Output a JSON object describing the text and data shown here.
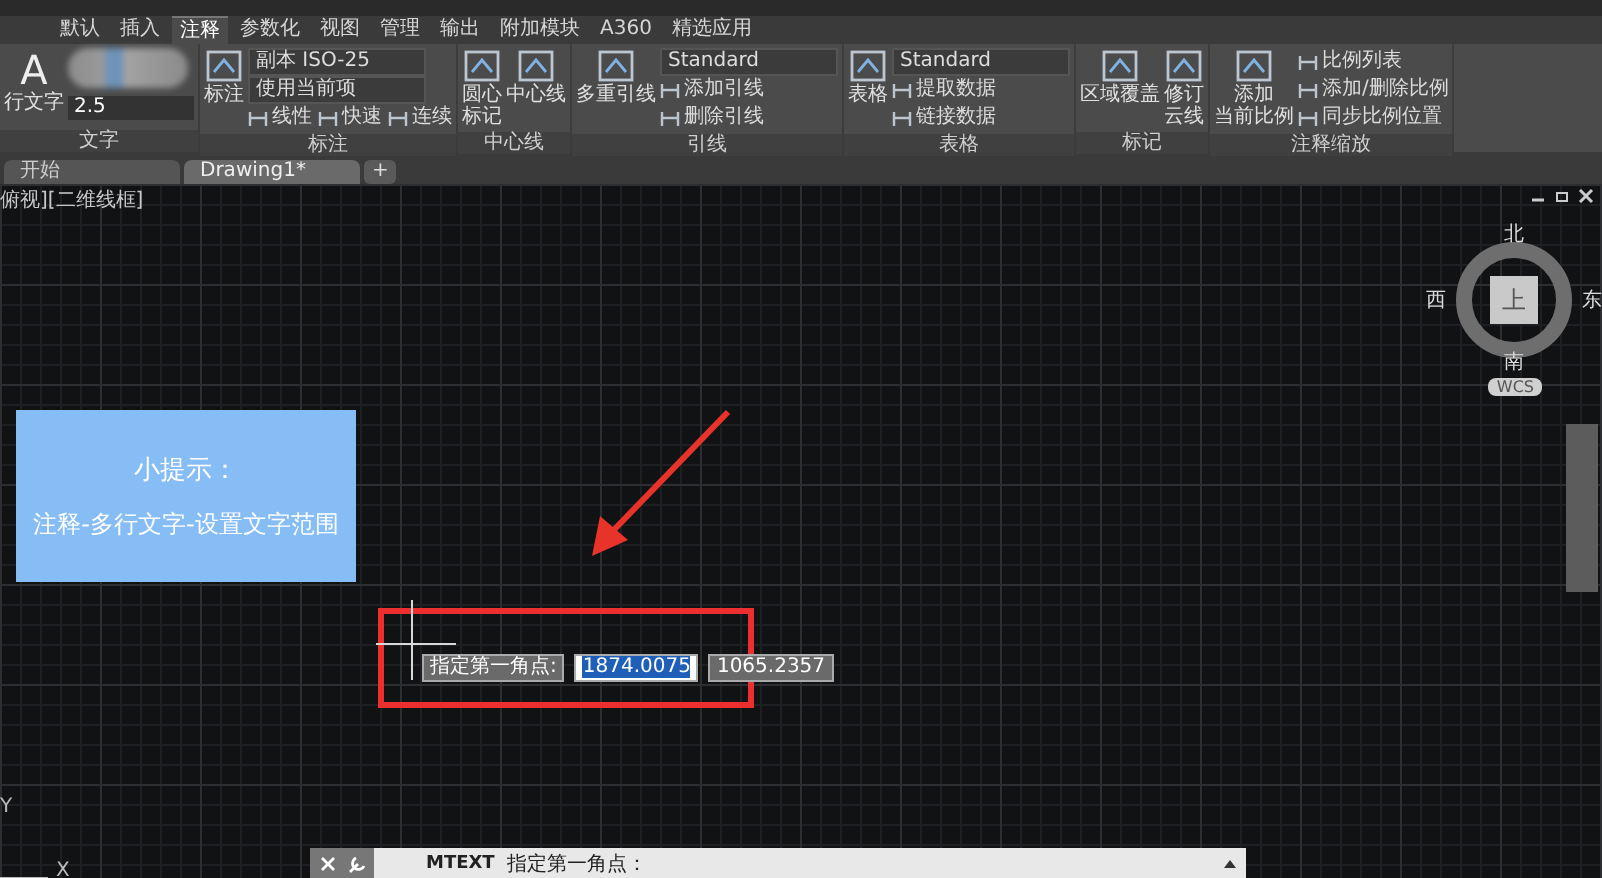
{
  "ribbon_tabs": [
    {
      "label": "默认",
      "selected": false
    },
    {
      "label": "插入",
      "selected": false
    },
    {
      "label": "注释",
      "selected": true
    },
    {
      "label": "参数化",
      "selected": false
    },
    {
      "label": "视图",
      "selected": false
    },
    {
      "label": "管理",
      "selected": false
    },
    {
      "label": "输出",
      "selected": false
    },
    {
      "label": "附加模块",
      "selected": false
    },
    {
      "label": "A360",
      "selected": false
    },
    {
      "label": "精选应用",
      "selected": false
    }
  ],
  "panels": [
    {
      "title": "文字",
      "large": [
        {
          "label": [
            "行文字"
          ],
          "glyph": "A"
        }
      ],
      "rows": [
        [
          {
            "kind": "blur"
          }
        ],
        [
          {
            "kind": "field",
            "value": "2.5"
          }
        ]
      ]
    },
    {
      "title": "标注",
      "large": [
        {
          "label": [
            "标注"
          ]
        }
      ],
      "rows": [
        [
          {
            "kind": "dropdown",
            "value": "副本 ISO-25"
          }
        ],
        [
          {
            "kind": "dropdown",
            "value": "使用当前项"
          }
        ],
        [
          {
            "kind": "small",
            "label": "线性"
          },
          {
            "kind": "small",
            "label": "快速"
          },
          {
            "kind": "small",
            "label": "连续"
          }
        ]
      ]
    },
    {
      "title": "中心线",
      "large": [
        {
          "label": [
            "圆心",
            "标记"
          ]
        },
        {
          "label": [
            "中心线"
          ]
        }
      ]
    },
    {
      "title": "引线",
      "large": [
        {
          "label": [
            "多重引线"
          ]
        }
      ],
      "rows": [
        [
          {
            "kind": "dropdown",
            "value": "Standard"
          }
        ],
        [
          {
            "kind": "small",
            "label": "添加引线"
          }
        ],
        [
          {
            "kind": "small",
            "label": "删除引线"
          }
        ]
      ]
    },
    {
      "title": "表格",
      "large": [
        {
          "label": [
            "表格"
          ]
        }
      ],
      "rows": [
        [
          {
            "kind": "dropdown",
            "value": "Standard"
          }
        ],
        [
          {
            "kind": "small",
            "label": "提取数据"
          }
        ],
        [
          {
            "kind": "small",
            "label": "链接数据"
          }
        ]
      ]
    },
    {
      "title": "标记",
      "large": [
        {
          "label": [
            "区域覆盖"
          ]
        },
        {
          "label": [
            "修订",
            "云线"
          ]
        }
      ]
    },
    {
      "title": "注释缩放",
      "large": [
        {
          "label": [
            "添加",
            "当前比例"
          ]
        }
      ],
      "rows": [
        [
          {
            "kind": "small",
            "label": "比例列表"
          }
        ],
        [
          {
            "kind": "small",
            "label": "添加/删除比例"
          }
        ],
        [
          {
            "kind": "small",
            "label": "同步比例位置"
          }
        ]
      ]
    }
  ],
  "file_tabs": [
    {
      "label": "开始",
      "selected": false
    },
    {
      "label": "Drawing1*",
      "selected": true
    }
  ],
  "new_tab": "+",
  "viewport_label": "俯视][二维线框]",
  "hint": {
    "title": "小提示：",
    "text": "注释-多行文字-设置文字范围"
  },
  "input_tooltip": {
    "prompt": "指定第一角点:",
    "inputs": [
      {
        "value": "1874.0075",
        "selected": true
      },
      {
        "value": "1065.2357",
        "selected": false
      }
    ]
  },
  "viewcube": {
    "north": "北",
    "west": "西",
    "face": "上",
    "east": "东",
    "south": "南",
    "coordinate_system": "WCS"
  },
  "ucs": {
    "y": "Y",
    "x": "X"
  },
  "command_line": {
    "command": "MTEXT",
    "prompt": "指定第一角点："
  }
}
